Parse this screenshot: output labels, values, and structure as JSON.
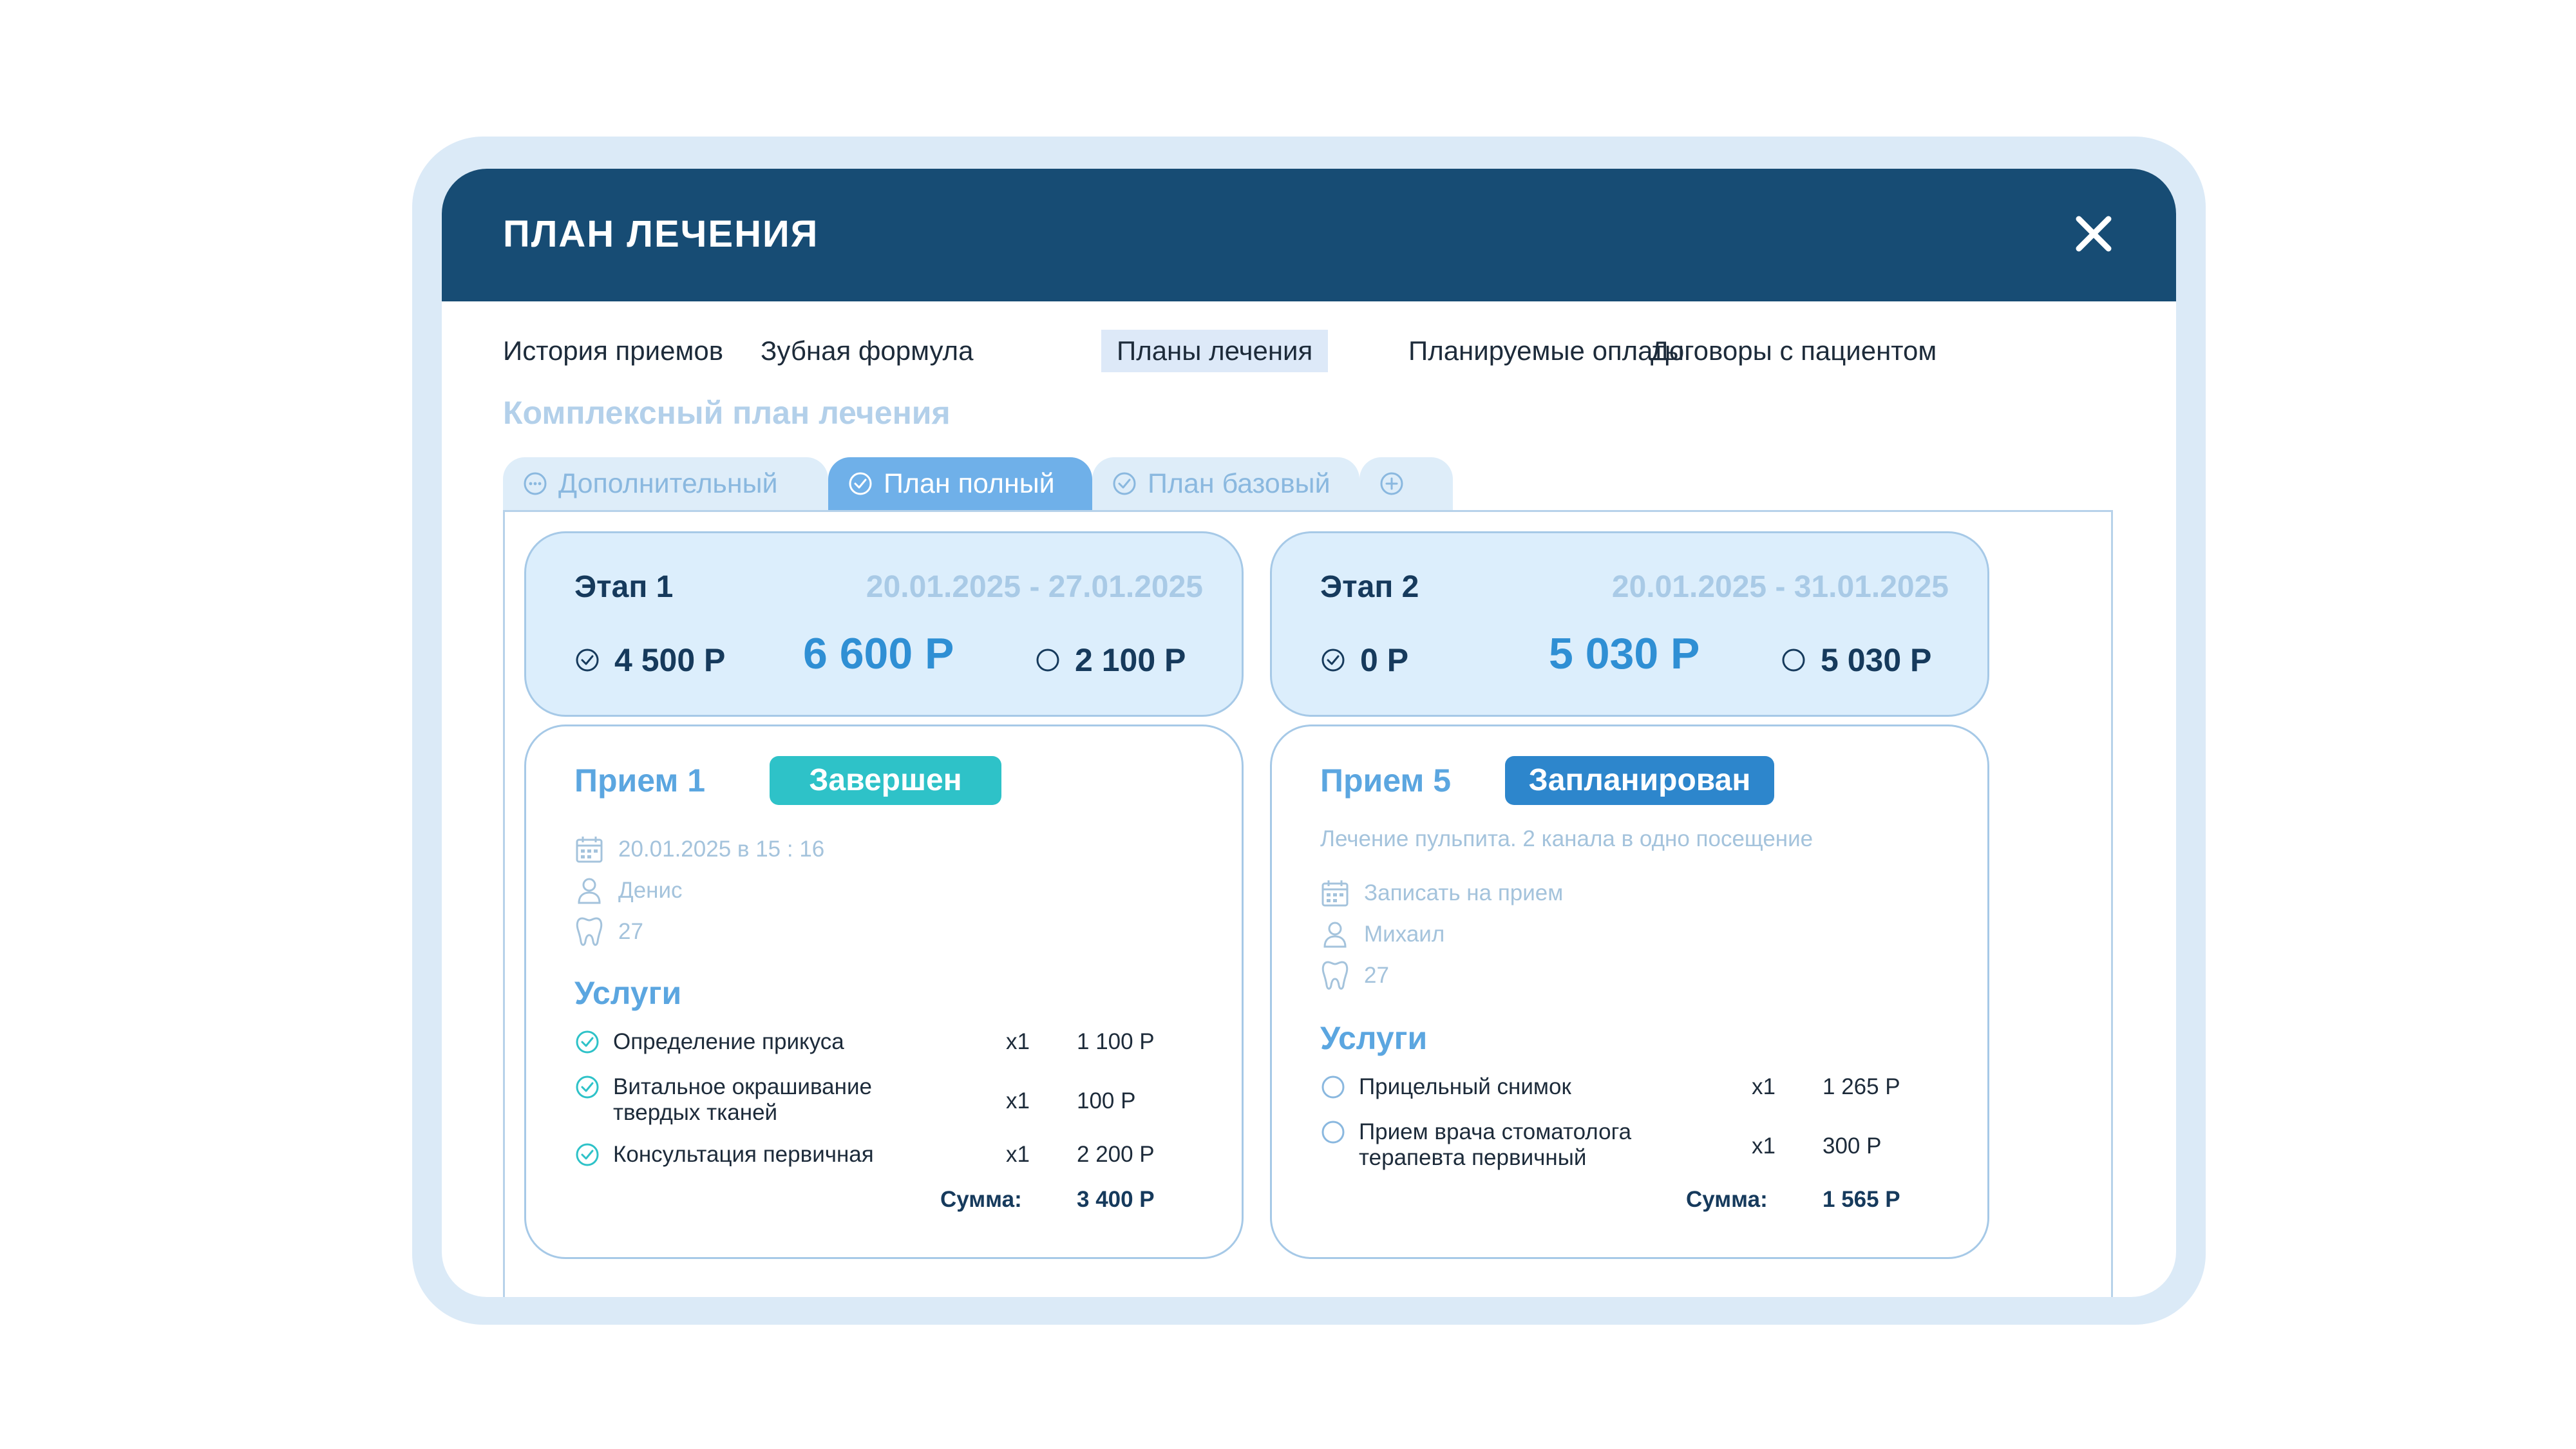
{
  "modal": {
    "title": "ПЛАН ЛЕЧЕНИЯ",
    "close_icon": "close-icon"
  },
  "tabs": [
    {
      "label": "История приемов",
      "active": false
    },
    {
      "label": "Зубная формула",
      "active": false
    },
    {
      "label": "Планы лечения",
      "active": true
    },
    {
      "label": "Планируемые оплаты",
      "active": false
    },
    {
      "label": "Договоры с пациентом",
      "active": false
    }
  ],
  "section_title": "Комплексный план лечения",
  "plan_tabs": [
    {
      "label": "Дополнительный",
      "icon": "more-circle-icon",
      "active": false
    },
    {
      "label": "План полный",
      "icon": "check-circle-icon",
      "active": true
    },
    {
      "label": "План базовый",
      "icon": "check-circle-icon",
      "active": false
    },
    {
      "label": "",
      "icon": "plus-circle-icon",
      "active": false
    }
  ],
  "stages": [
    {
      "name": "Этап 1",
      "dates": "20.01.2025 - 27.01.2025",
      "paid": "4 500 Р",
      "total": "6 600 Р",
      "remaining": "2 100 Р"
    },
    {
      "name": "Этап 2",
      "dates": "20.01.2025 - 31.01.2025",
      "paid": "0 Р",
      "total": "5 030 Р",
      "remaining": "5 030 Р"
    }
  ],
  "visits": [
    {
      "name": "Прием 1",
      "status": "Завершен",
      "status_color": "#2ec2c8",
      "description": "",
      "datetime": "20.01.2025 в 15 : 16",
      "doctor": "Денис",
      "tooth": "27",
      "services_title": "Услуги",
      "services": [
        {
          "name": "Определение прикуса",
          "qty": "x1",
          "price": "1 100 Р",
          "done": true
        },
        {
          "name": "Витальное окрашивание твердых тканей",
          "qty": "x1",
          "price": "100 Р",
          "done": true
        },
        {
          "name": "Консультация первичная",
          "qty": "x1",
          "price": "2 200 Р",
          "done": true
        }
      ],
      "sum_label": "Сумма:",
      "sum": "3 400 Р"
    },
    {
      "name": "Прием 5",
      "status": "Запланирован",
      "status_color": "#2d86cc",
      "description": "Лечение пульпита. 2 канала в одно посещение",
      "datetime": "Записать на прием",
      "doctor": "Михаил",
      "tooth": "27",
      "services_title": "Услуги",
      "services": [
        {
          "name": "Прицельный снимок",
          "qty": "x1",
          "price": "1 265 Р",
          "done": false
        },
        {
          "name": "Прием врача стоматолога терапевта первичный",
          "qty": "x1",
          "price": "300 Р",
          "done": false
        }
      ],
      "sum_label": "Сумма:",
      "sum": "1 565 Р"
    }
  ],
  "colors": {
    "header": "#174c74",
    "accent": "#2f8fd4",
    "completed": "#2ec2c8",
    "planned": "#2d86cc"
  }
}
